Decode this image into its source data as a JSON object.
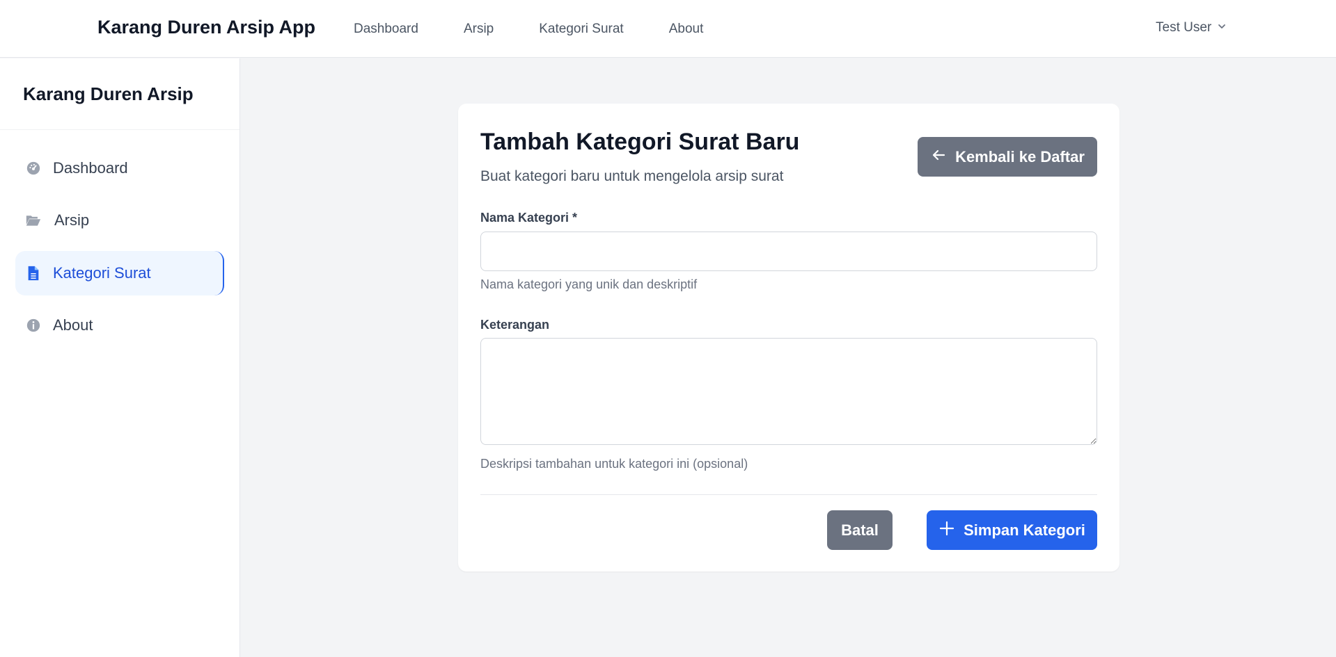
{
  "navbar": {
    "brand": "Karang Duren Arsip App",
    "links": [
      "Dashboard",
      "Arsip",
      "Kategori Surat",
      "About"
    ],
    "user": "Test User"
  },
  "sidebar": {
    "title": "Karang Duren Arsip",
    "items": [
      {
        "label": "Dashboard",
        "icon": "gauge-icon"
      },
      {
        "label": "Arsip",
        "icon": "folder-open-icon"
      },
      {
        "label": "Kategori Surat",
        "icon": "file-icon",
        "active": true
      },
      {
        "label": "About",
        "icon": "info-icon"
      }
    ]
  },
  "form": {
    "title": "Tambah Kategori Surat Baru",
    "subtitle": "Buat kategori baru untuk mengelola arsip surat",
    "back_label": "Kembali ke Daftar",
    "name_label": "Nama Kategori *",
    "name_value": "",
    "name_help": "Nama kategori yang unik dan deskriptif",
    "desc_label": "Keterangan",
    "desc_value": "",
    "desc_help": "Deskripsi tambahan untuk kategori ini (opsional)",
    "cancel_label": "Batal",
    "save_label": "Simpan Kategori"
  },
  "colors": {
    "primary": "#2563eb",
    "secondary": "#6b7280",
    "active_bg": "#eff6ff",
    "page_bg": "#f3f4f6"
  }
}
